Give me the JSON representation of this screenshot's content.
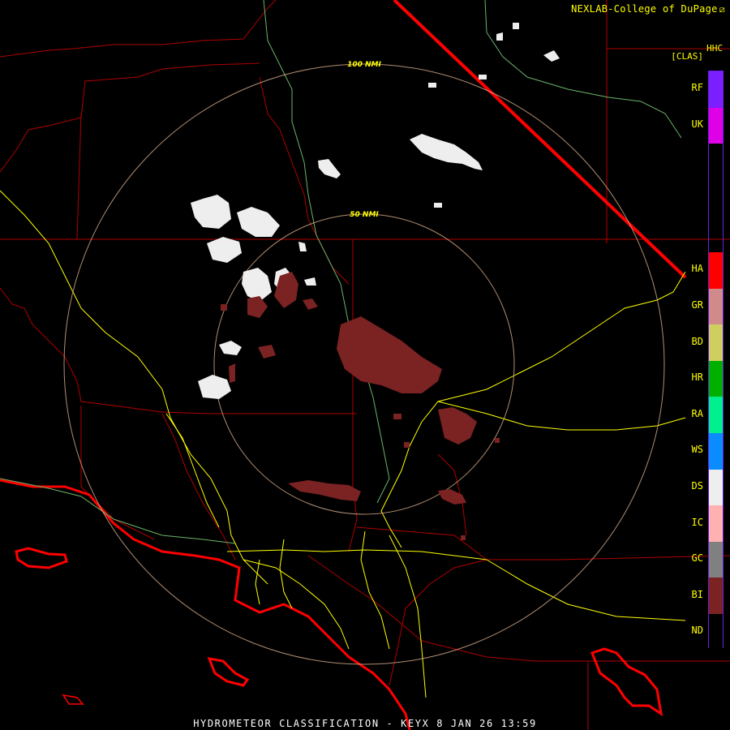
{
  "header": {
    "credit": "NEXLAB-College of DuPage",
    "product_code": "HHC",
    "product_unit": "[CLAS]"
  },
  "rings": [
    {
      "label": "100 NMI"
    },
    {
      "label": "50 NMI"
    }
  ],
  "legend": {
    "items": [
      {
        "code": "RF",
        "color": "#7b1fff"
      },
      {
        "code": "UK",
        "color": "#e000e8"
      },
      {
        "code": "HA",
        "color": "#ff0000"
      },
      {
        "code": "GR",
        "color": "#d08a8a"
      },
      {
        "code": "BD",
        "color": "#cfcf60"
      },
      {
        "code": "HR",
        "color": "#00b000"
      },
      {
        "code": "RA",
        "color": "#00f090"
      },
      {
        "code": "WS",
        "color": "#0a8cff"
      },
      {
        "code": "DS",
        "color": "#eeeeee"
      },
      {
        "code": "IC",
        "color": "#ffb0b0"
      },
      {
        "code": "GC",
        "color": "#808080"
      },
      {
        "code": "BI",
        "color": "#7b2222"
      },
      {
        "code": "ND",
        "color": "#000000"
      }
    ]
  },
  "map_colors": {
    "boundary": "#b00000",
    "state_line": "#ff0000",
    "highway": "#ffff00",
    "river": "#6ab46a",
    "ring": "#ddb08f"
  },
  "footer": {
    "caption": "HYDROMETEOR CLASSIFICATION - KEYX 8 JAN 26 13:59"
  }
}
